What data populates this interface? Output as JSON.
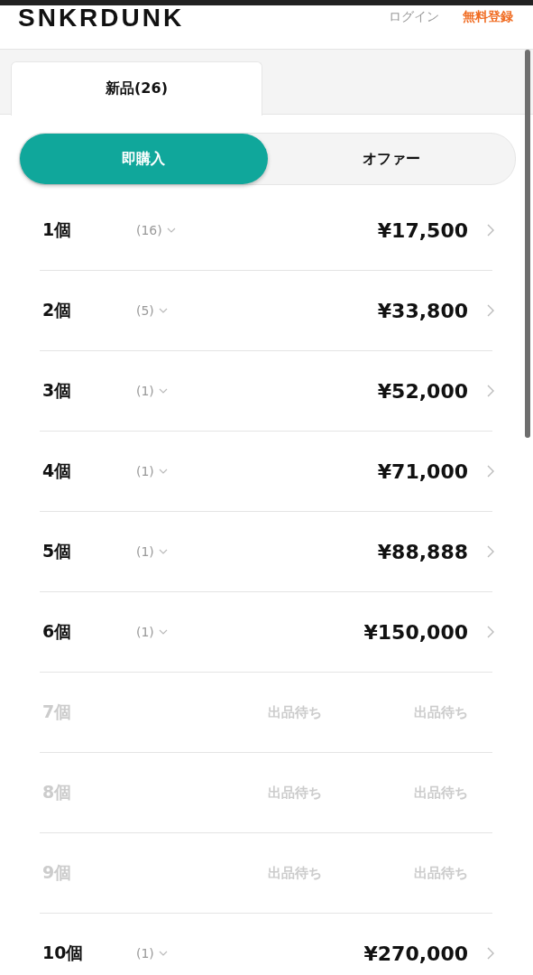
{
  "header": {
    "logo": "SNKRDUNK",
    "login": "ログイン",
    "signup": "無料登録"
  },
  "tabs": [
    {
      "label": "新品(26)",
      "selected": true
    }
  ],
  "toggle": [
    {
      "label": "即購入",
      "selected": true
    },
    {
      "label": "オファー",
      "selected": false
    }
  ],
  "rows": [
    {
      "kind": "listed",
      "quantity": "1個",
      "count": "(16)",
      "price": "¥17,500"
    },
    {
      "kind": "listed",
      "quantity": "2個",
      "count": "(5)",
      "price": "¥33,800"
    },
    {
      "kind": "listed",
      "quantity": "3個",
      "count": "(1)",
      "price": "¥52,000"
    },
    {
      "kind": "listed",
      "quantity": "4個",
      "count": "(1)",
      "price": "¥71,000"
    },
    {
      "kind": "listed",
      "quantity": "5個",
      "count": "(1)",
      "price": "¥88,888"
    },
    {
      "kind": "listed",
      "quantity": "6個",
      "count": "(1)",
      "price": "¥150,000"
    },
    {
      "kind": "waiting",
      "quantity": "7個",
      "status_1": "出品待ち",
      "status_2": "出品待ち"
    },
    {
      "kind": "waiting",
      "quantity": "8個",
      "status_1": "出品待ち",
      "status_2": "出品待ち"
    },
    {
      "kind": "waiting",
      "quantity": "9個",
      "status_1": "出品待ち",
      "status_2": "出品待ち"
    },
    {
      "kind": "listed",
      "quantity": "10個",
      "count": "(1)",
      "price": "¥270,000"
    }
  ]
}
